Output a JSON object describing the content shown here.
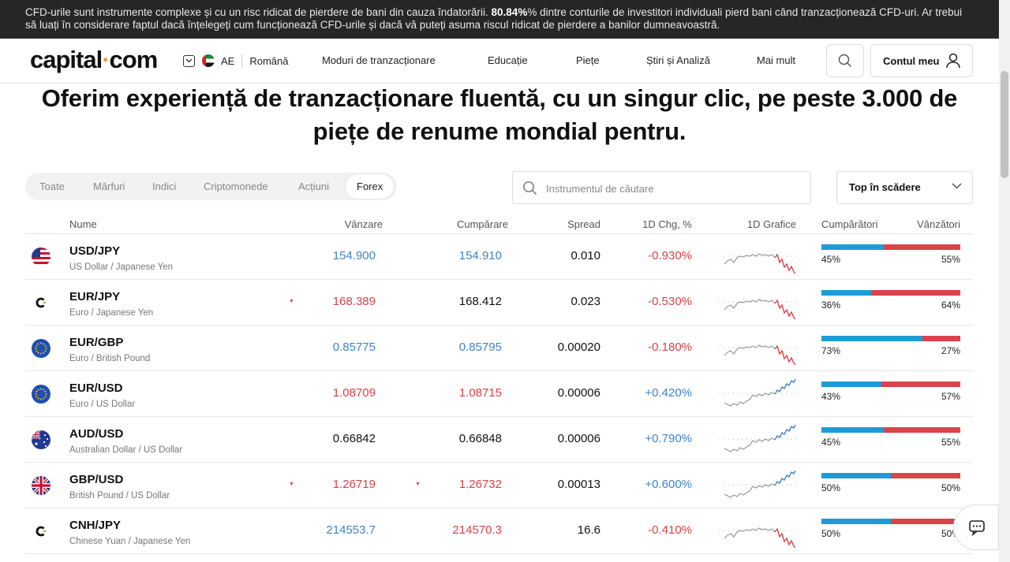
{
  "risk": {
    "pre": "CFD-urile sunt instrumente complexe și cu un risc ridicat de pierdere de bani din cauza îndatorării. ",
    "pct": "80.84%",
    "post": "% dintre conturile de investitori individuali pierd bani când tranzacționează CFD-uri. Ar trebui să luați în considerare faptul dacă înțelegeți cum funcționează CFD-urile și dacă vă puteți asuma riscul ridicat de pierdere a banilor dumneavoastră."
  },
  "header": {
    "logo_main": "capital",
    "logo_dot": "·",
    "logo_tail": "com",
    "region": "AE",
    "language": "Română",
    "nav": [
      "Moduri de tranzacționare",
      "Educație",
      "Piețe",
      "Știri și Analiză",
      "Mai mult"
    ],
    "account": "Contul meu"
  },
  "heading": "Oferim experiență de tranzacționare fluentă, cu un singur clic, pe peste 3.000 de piețe de renume mondial pentru.",
  "tabs": [
    "Toate",
    "Mărfuri",
    "Indici",
    "Criptomonede",
    "Acțiuni",
    "Forex"
  ],
  "active_tab": "Forex",
  "search": {
    "placeholder": "Instrumentul de căutare"
  },
  "sort": {
    "selected": "Top în scădere"
  },
  "columns": [
    "Nume",
    "Vânzare",
    "Cumpărare",
    "Spread",
    "1D Chg, %",
    "1D Grafice",
    "Cumpărători",
    "Vânzători"
  ],
  "colors": {
    "up": "#3f84c6",
    "down": "#d9434a",
    "buyers": "#1e9bd6",
    "sellers": "#d9434a"
  },
  "rows": [
    {
      "symbol": "USD/JPY",
      "name": "US Dollar / Japanese Yen",
      "flag": "us-flag",
      "sell": "154.900",
      "buy": "154.910",
      "spread": "0.010",
      "chg": "-0.930%",
      "buyers_pct": "45%",
      "sellers_pct": "55%",
      "buyers": 45,
      "sell_color": "blue",
      "buy_color": "blue",
      "chg_dir": "down",
      "sell_tri": false,
      "buy_tri": false,
      "spark": "down"
    },
    {
      "symbol": "EUR/JPY",
      "name": "Euro / Japanese Yen",
      "flag": "capital-icon",
      "sell": "168.389",
      "buy": "168.412",
      "spread": "0.023",
      "chg": "-0.530%",
      "buyers_pct": "36%",
      "sellers_pct": "64%",
      "buyers": 36,
      "sell_color": "red",
      "buy_color": "dark",
      "chg_dir": "down",
      "sell_tri": true,
      "buy_tri": false,
      "spark": "down"
    },
    {
      "symbol": "EUR/GBP",
      "name": "Euro / British Pound",
      "flag": "eu-flag",
      "sell": "0.85775",
      "buy": "0.85795",
      "spread": "0.00020",
      "chg": "-0.180%",
      "buyers_pct": "73%",
      "sellers_pct": "27%",
      "buyers": 73,
      "sell_color": "blue",
      "buy_color": "blue",
      "chg_dir": "down",
      "sell_tri": false,
      "buy_tri": false,
      "spark": "down"
    },
    {
      "symbol": "EUR/USD",
      "name": "Euro / US Dollar",
      "flag": "eu-flag",
      "sell": "1.08709",
      "buy": "1.08715",
      "spread": "0.00006",
      "chg": "+0.420%",
      "buyers_pct": "43%",
      "sellers_pct": "57%",
      "buyers": 43,
      "sell_color": "red",
      "buy_color": "red",
      "chg_dir": "up",
      "sell_tri": false,
      "buy_tri": false,
      "spark": "up"
    },
    {
      "symbol": "AUD/USD",
      "name": "Australian Dollar / US Dollar",
      "flag": "au-flag",
      "sell": "0.66842",
      "buy": "0.66848",
      "spread": "0.00006",
      "chg": "+0.790%",
      "buyers_pct": "45%",
      "sellers_pct": "55%",
      "buyers": 45,
      "sell_color": "dark",
      "buy_color": "dark",
      "chg_dir": "up",
      "sell_tri": false,
      "buy_tri": false,
      "spark": "up"
    },
    {
      "symbol": "GBP/USD",
      "name": "British Pound / US Dollar",
      "flag": "gb-flag",
      "sell": "1.26719",
      "buy": "1.26732",
      "spread": "0.00013",
      "chg": "+0.600%",
      "buyers_pct": "50%",
      "sellers_pct": "50%",
      "buyers": 50,
      "sell_color": "red",
      "buy_color": "red",
      "chg_dir": "up",
      "sell_tri": true,
      "buy_tri": true,
      "spark": "up"
    },
    {
      "symbol": "CNH/JPY",
      "name": "Chinese Yuan / Japanese Yen",
      "flag": "capital-icon",
      "sell": "214553.7",
      "buy": "214570.3",
      "spread": "16.6",
      "chg": "-0.410%",
      "buyers_pct": "50%",
      "sellers_pct": "50%",
      "buyers": 50,
      "sell_color": "blue",
      "buy_color": "red",
      "chg_dir": "down",
      "sell_tri": false,
      "buy_tri": false,
      "spark": "down"
    }
  ]
}
